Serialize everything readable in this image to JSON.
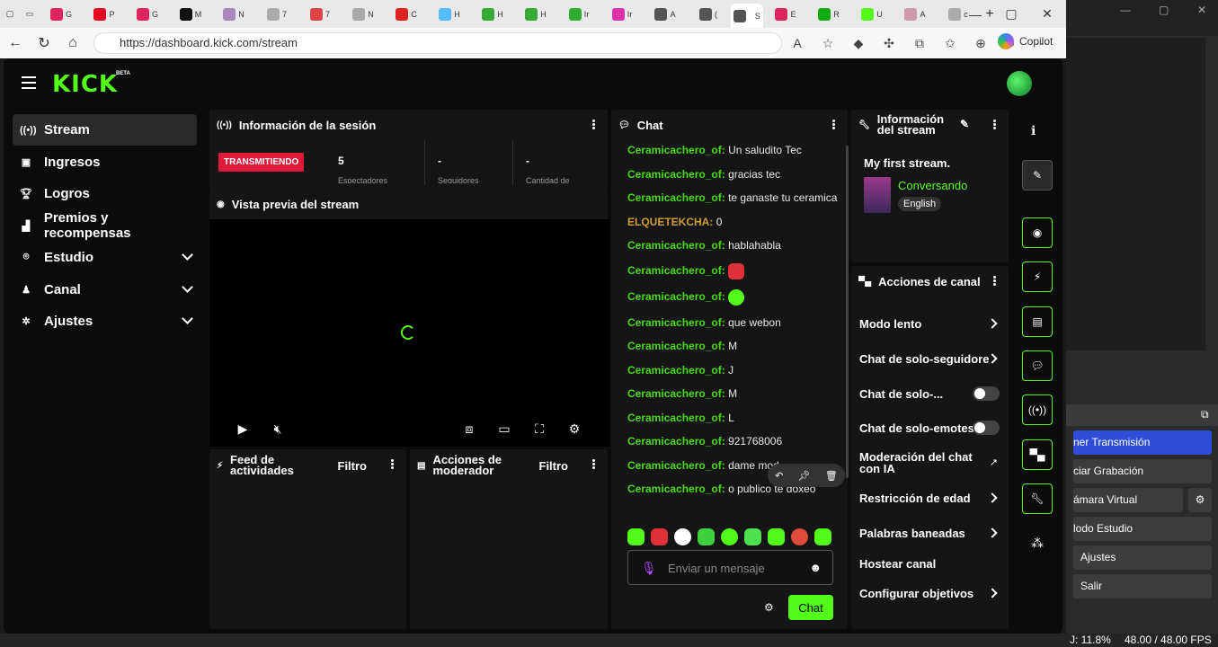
{
  "browser": {
    "url": "https://dashboard.kick.com/stream",
    "copilot_label": "Copilot",
    "tab_letters": [
      "G",
      "P",
      "G",
      "M",
      "N",
      "7",
      "7",
      "N",
      "C",
      "H",
      "H",
      "H",
      "Ir",
      "Ir",
      "A",
      "(",
      "S",
      "E",
      "R",
      "U",
      "A",
      "c"
    ]
  },
  "sidebar": {
    "items": [
      {
        "label": "Stream",
        "icon": "stream-icon"
      },
      {
        "label": "Ingresos",
        "icon": "revenue-icon"
      },
      {
        "label": "Logros",
        "icon": "trophy-icon"
      },
      {
        "label": "Premios y recompensas",
        "icon": "rewards-icon"
      },
      {
        "label": "Estudio",
        "icon": "studio-icon"
      },
      {
        "label": "Canal",
        "icon": "channel-icon"
      },
      {
        "label": "Ajustes",
        "icon": "settings-icon"
      }
    ]
  },
  "logo": {
    "text": "KICK",
    "beta": "BETA"
  },
  "session": {
    "title": "Información de la sesión",
    "status": "TRANSMITIENDO",
    "stats": [
      {
        "value": "5",
        "label": "Espectadores"
      },
      {
        "value": "-",
        "label": "Seguidores"
      },
      {
        "value": "-",
        "label": "Cantidad de"
      }
    ]
  },
  "preview": {
    "title": "Vista previa del stream"
  },
  "feed": {
    "title": "Feed de actividades",
    "filter": "Filtro"
  },
  "modactions": {
    "title": "Acciones de moderador",
    "filter": "Filtro"
  },
  "chat": {
    "title": "Chat",
    "messages": [
      {
        "user": "Ceramicachero_of:",
        "text": "Un saludito Tec"
      },
      {
        "user": "Ceramicachero_of:",
        "text": "gracias tec"
      },
      {
        "user": "Ceramicachero_of:",
        "text": "te ganaste tu ceramica"
      },
      {
        "user": "ELQUETEKCHA:",
        "text": "0"
      },
      {
        "user": "Ceramicachero_of:",
        "text": "hablahabla"
      },
      {
        "user": "Ceramicachero_of:",
        "text": ""
      },
      {
        "user": "Ceramicachero_of:",
        "text": ""
      },
      {
        "user": "Ceramicachero_of:",
        "text": "que webon"
      },
      {
        "user": "Ceramicachero_of:",
        "text": "M"
      },
      {
        "user": "Ceramicachero_of:",
        "text": "J"
      },
      {
        "user": "Ceramicachero_of:",
        "text": "M"
      },
      {
        "user": "Ceramicachero_of:",
        "text": "L"
      },
      {
        "user": "Ceramicachero_of:",
        "text": "921768006"
      },
      {
        "user": "Ceramicachero_of:",
        "text": "dame mod"
      },
      {
        "user": "Ceramicachero_of:",
        "text": "o publico te doxeo"
      }
    ],
    "placeholder": "Enviar un mensaje",
    "send_label": "Chat"
  },
  "stream_info": {
    "title": "Información del stream",
    "stream_title": "My first stream.",
    "category": "Conversando",
    "language": "English",
    "category_color": "#53fc18"
  },
  "channel_actions": {
    "title": "Acciones de canal",
    "items": [
      {
        "label": "Modo lento",
        "kind": "chevron"
      },
      {
        "label": "Chat de solo-seguidores",
        "kind": "chevron"
      },
      {
        "label": "Chat de solo-...",
        "kind": "toggle"
      },
      {
        "label": "Chat de solo-emotes",
        "kind": "toggle"
      },
      {
        "label": "Moderación del chat con IA",
        "kind": "external"
      },
      {
        "label": "Restricción de edad",
        "kind": "chevron"
      },
      {
        "label": "Palabras baneadas",
        "kind": "chevron"
      },
      {
        "label": "Hostear canal",
        "kind": "none"
      },
      {
        "label": "Configurar objetivos",
        "kind": "chevron"
      }
    ]
  },
  "obs": {
    "buttons": [
      "ner Transmisión",
      "ciar Grabación",
      "ámara Virtual",
      "lodo Estudio",
      "Ajustes",
      "Salir"
    ],
    "status_cpu": "J: 11.8%",
    "status_fps": "48.00 / 48.00 FPS"
  },
  "colors": {
    "accent": "#53fc18",
    "live": "#e01b3a",
    "obs_blue": "#2f4dd6"
  }
}
